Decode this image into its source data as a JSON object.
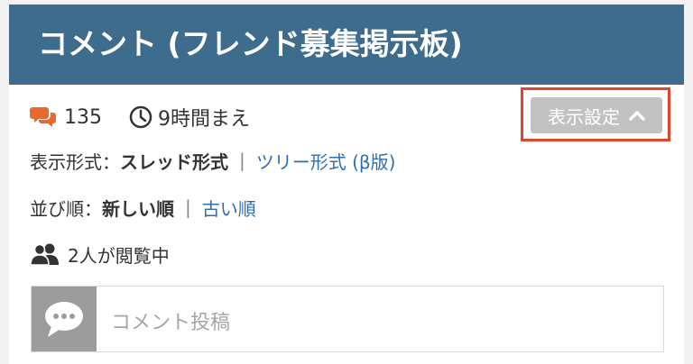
{
  "header": {
    "title": "コメント (フレンド募集掲示板)"
  },
  "meta": {
    "comment_count": "135",
    "time_ago": "9時間まえ"
  },
  "settings_button": {
    "label": "表示設定"
  },
  "display_format": {
    "label": "表示形式：",
    "current": "スレッド形式",
    "separator": "|",
    "alternative": "ツリー形式 (β版)"
  },
  "sort_order": {
    "label": "並び順：",
    "current": "新しい順",
    "separator": "|",
    "alternative": "古い順"
  },
  "viewers": {
    "text": "2人が閲覧中"
  },
  "post": {
    "placeholder": "コメント投稿"
  },
  "colors": {
    "header_bg": "#3e6c8c",
    "accent_orange": "#e8692e",
    "link_blue": "#2f6fb0",
    "highlight_red": "#e2452b",
    "button_gray": "#c2c2c2"
  },
  "icons": [
    "comments-icon",
    "clock-icon",
    "chevron-up-icon",
    "users-icon",
    "speech-bubble-icon"
  ]
}
